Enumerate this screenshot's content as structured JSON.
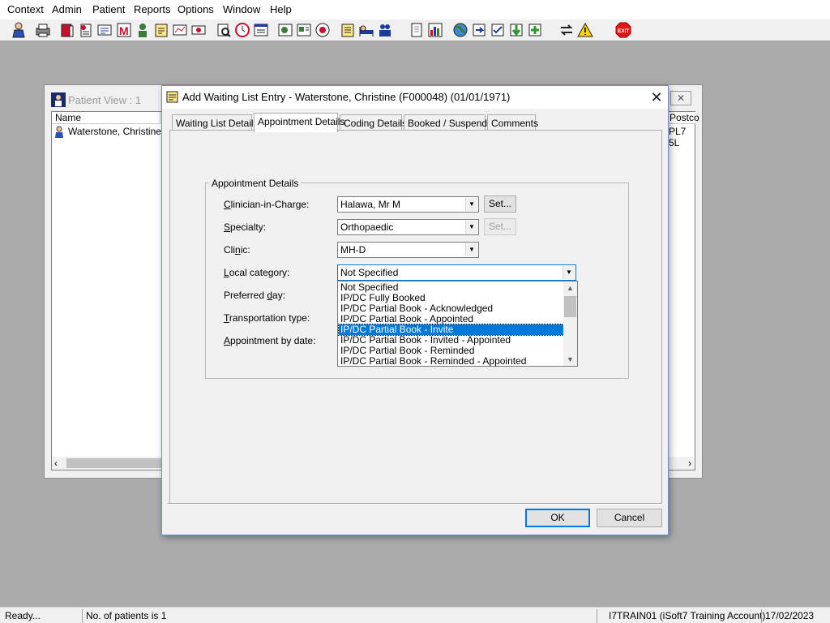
{
  "menu": [
    "Context",
    "Admin",
    "Patient",
    "Reports",
    "Options",
    "Window",
    "Help"
  ],
  "toolbar": {
    "icons": [
      "patient-icon",
      "printer-icon",
      "book-icon",
      "page-icon",
      "list-icon",
      "m-icon",
      "person-icon",
      "note-icon",
      "chart-icon",
      "document-icon",
      "search-icon",
      "clock-icon",
      "window-icon",
      "photo-icon",
      "card-icon",
      "stamp-icon",
      "note2-icon",
      "bed-icon",
      "people-icon",
      "page2-icon",
      "bar-chart-icon",
      "globe-icon",
      "arrow-doc-icon",
      "check-doc-icon",
      "green-arrow-icon",
      "green-doc-icon",
      "transfer-icon",
      "warning-icon",
      "exit-icon"
    ],
    "exit_label": "EXIT"
  },
  "patient_view": {
    "title": "Patient View : 1",
    "columns": [
      "Name",
      "Postco"
    ],
    "rows": [
      {
        "name": "Waterstone, Christine...",
        "postcode": "PL7 5L"
      }
    ]
  },
  "dialog": {
    "title": "Add Waiting List Entry - Waterstone, Christine (F000048) (01/01/1971)",
    "close": "✕",
    "tabs": [
      "Waiting List Details",
      "Appointment Details",
      "Coding Details",
      "Booked / Suspend",
      "Comments"
    ],
    "active_tab": "Appointment Details",
    "group_title": "Appointment Details",
    "fields": {
      "clinician_label": {
        "prefix": "",
        "ul": "C",
        "rest": "linician-in-Charge:"
      },
      "clinician_value": "Halawa, Mr M",
      "specialty_label": {
        "prefix": "",
        "ul": "S",
        "rest": "pecialty:"
      },
      "specialty_value": "Orthopaedic",
      "clinic_label": {
        "prefix": "Cli",
        "ul": "n",
        "rest": "ic:"
      },
      "clinic_value": "MH-D",
      "local_category_label": {
        "prefix": "",
        "ul": "L",
        "rest": "ocal category:"
      },
      "local_category_value": "Not Specified",
      "preferred_day_label": {
        "prefix": "Preferred ",
        "ul": "d",
        "rest": "ay:"
      },
      "transportation_label": {
        "prefix": "",
        "ul": "T",
        "rest": "ransportation type:"
      },
      "appointment_by_date_label": {
        "prefix": "",
        "ul": "A",
        "rest": "ppointment by date:"
      }
    },
    "set_button": "Set...",
    "dropdown_options": [
      "Not Specified",
      "IP/DC Fully Booked",
      "IP/DC Partial Book - Acknowledged",
      "IP/DC Partial Book - Appointed",
      "IP/DC Partial Book - Invite",
      "IP/DC Partial Book - Invited - Appointed",
      "IP/DC Partial Book - Reminded",
      "IP/DC Partial Book - Reminded - Appointed"
    ],
    "dropdown_selected_index": 4,
    "ok": "OK",
    "cancel": "Cancel"
  },
  "status": {
    "ready": "Ready...",
    "patients": "No. of patients is 1",
    "user": "I7TRAIN01 (iSoft7 Training Account)",
    "date": "17/02/2023"
  },
  "colors": {
    "selection": "#0078d7",
    "background": "#ababab"
  }
}
